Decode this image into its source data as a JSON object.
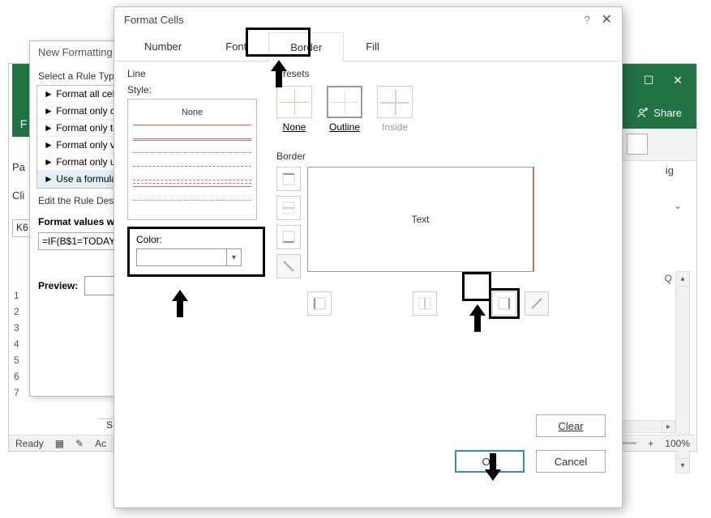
{
  "excel": {
    "win": {
      "minimize": "☐",
      "close": "✕"
    },
    "share": "Share",
    "pa": "Pa",
    "cli": "Cli",
    "name_box": "K6",
    "ng": "ig",
    "col_q": "Q",
    "rows": [
      "1",
      "2",
      "3",
      "4",
      "5",
      "6",
      "7"
    ],
    "sheet": "S",
    "status": {
      "ready": "Ready",
      "acc": "Ac",
      "zoom": "100%",
      "plus": "+",
      "minus": "—"
    }
  },
  "rule_dialog": {
    "title": "New Formatting",
    "select_rule": "Select a Rule Type",
    "rules": [
      "Format all cell",
      "Format only ce",
      "Format only to",
      "Format only va",
      "Format only ur",
      "Use a formula"
    ],
    "edit_desc": "Edit the Rule Desc",
    "format_values": "Format values w",
    "formula": "=IF(B$1=TODAY",
    "preview": "Preview:"
  },
  "format_dialog": {
    "title": "Format Cells",
    "help": "?",
    "close": "✕",
    "tabs": {
      "number": "Number",
      "font": "Font",
      "border": "Border",
      "fill": "Fill"
    },
    "line": {
      "label": "Line",
      "style": "Style:",
      "none": "None"
    },
    "color": {
      "label": "Color:",
      "value": "#ff0000"
    },
    "presets": {
      "label": "Presets",
      "none": "None",
      "outline": "Outline",
      "inside": "Inside"
    },
    "border": {
      "label": "Border",
      "text": "Text"
    },
    "buttons": {
      "clear": "Clear",
      "ok": "OK",
      "cancel": "Cancel"
    }
  }
}
